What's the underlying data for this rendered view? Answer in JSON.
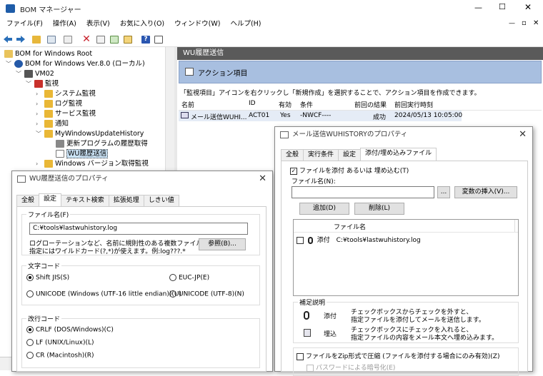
{
  "window": {
    "title": "BOM マネージャー",
    "controls": [
      "—",
      "☐",
      "✕"
    ]
  },
  "menu": [
    "ファイル(F)",
    "操作(A)",
    "表示(V)",
    "お気に入り(O)",
    "ウィンドウ(W)",
    "ヘルプ(H)"
  ],
  "mdi_controls": [
    "—",
    "▫",
    "✕"
  ],
  "tree": {
    "root": "BOM for Windows Root",
    "instance": "BOM for Windows Ver.8.0 (ローカル)",
    "host": "VM02",
    "monitor": "監視",
    "items": [
      "システム監視",
      "ログ監視",
      "サービス監視",
      "通知",
      "MyWindowsUpdateHistory"
    ],
    "sub1": "更新プログラムの履歴取得",
    "sub2": "WU履歴送信",
    "item_last": "Windows バージョン取得監視"
  },
  "right_panel": {
    "header": "WU履歴送信",
    "section": "アクション項目",
    "hint": "「監視項目」アイコンを右クリックし「新規作成」を選択することで、アクション項目を作成できます。",
    "columns": [
      "名前",
      "ID",
      "有効",
      "条件",
      "前回の結果",
      "前回実行時刻"
    ],
    "row": {
      "name": "メール送信WUHI...",
      "id": "ACT01",
      "enabled": "Yes",
      "cond": "-NWCF----",
      "result": "成功",
      "time": "2024/05/13 10:05:00"
    }
  },
  "dlg_left": {
    "title": "WU履歴送信のプロパティ",
    "tabs": [
      "全般",
      "設定",
      "テキスト検索",
      "拡張処理",
      "しきい値"
    ],
    "file_group": "ファイル名(F)",
    "file_value": "C:¥tools¥lastwuhistory.log",
    "note1": "ログローテーションなど、名前に規則性のある複数ファイルの",
    "note2": "指定にはワイルドカード(?,*)が使えます。例:log???.*",
    "browse": "参照(B)...",
    "charset_group": "文字コード",
    "charsets": [
      "Shift JIS(S)",
      "EUC-JP(E)",
      "UNICODE (Windows (UTF-16 little endian))(U)",
      "UNICODE (UTF-8)(N)"
    ],
    "newline_group": "改行コード",
    "newlines": [
      "CRLF (DOS/Windows)(C)",
      "LF (UNIX/Linux)(L)",
      "CR (Macintosh)(R)"
    ]
  },
  "dlg_right": {
    "title": "メール送信WUHISTORYのプロパティ",
    "tabs": [
      "全般",
      "実行条件",
      "設定",
      "添付/埋め込みファイル"
    ],
    "attach_check": "ファイルを添付 あるいは 埋め込む(T)",
    "filename_label": "ファイル名(N):",
    "ellipsis": "...",
    "insert_var": "変数の挿入(V)...",
    "add": "追加(D)",
    "delete": "削除(L)",
    "list_header": "ファイル名",
    "list_item": {
      "mode": "添付",
      "path": "C:¥tools¥lastwuhistory.log"
    },
    "help_group": "補足説明",
    "help_attach_label": "添付",
    "help_attach_1": "チェックボックスからチェックを外すと、",
    "help_attach_2": "指定ファイルを添付してメールを送信します。",
    "help_embed_label": "埋込",
    "help_embed_1": "チェックボックスにチェックを入れると、",
    "help_embed_2": "指定ファイルの内容をメール本文へ埋め込みます。",
    "zip_check": "ファイルをZip形式で圧縮 (ファイルを添付する場合にのみ有効)(Z)",
    "pwd_check": "パスワードによる暗号化(E)"
  }
}
